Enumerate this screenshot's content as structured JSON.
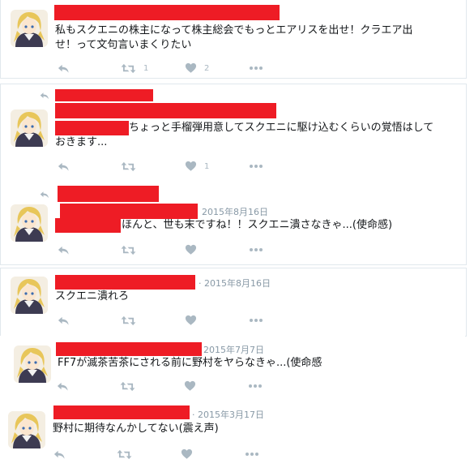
{
  "tweets": [
    {
      "text_lines": [
        "私もスクエニの株主になって株主総会でもっとエアリスを出せ！クラエア出",
        "せ！って文句言いまくりたい"
      ],
      "retweet_count": "1",
      "like_count": "2",
      "retweeted_reply": false,
      "date": ""
    },
    {
      "text_lines": [
        "ちょっと手榴弾用意してスクエニに駆け込むくらいの覚悟はして",
        "おきます..."
      ],
      "retweet_count": "",
      "like_count": "1",
      "retweeted_reply": true,
      "date": ""
    },
    {
      "text_lines": [
        "ほんと、世も末ですね！！スクエニ潰さなきゃ...(使命感)"
      ],
      "retweet_count": "",
      "like_count": "",
      "retweeted_reply": true,
      "date": "2015年8月16日"
    },
    {
      "text_lines": [
        "スクエニ潰れろ"
      ],
      "retweet_count": "",
      "like_count": "",
      "retweeted_reply": false,
      "date": "· 2015年8月16日"
    },
    {
      "text_lines": [
        "FF7が滅茶苦茶にされる前に野村をヤらなきゃ...(使命感"
      ],
      "retweet_count": "",
      "like_count": "",
      "retweeted_reply": false,
      "date": "2015年7月7日"
    },
    {
      "text_lines": [
        "野村に期待なんかしてない(震え声)"
      ],
      "retweet_count": "",
      "like_count": "",
      "retweeted_reply": false,
      "date": "· 2015年3月17日"
    }
  ],
  "colors": {
    "redaction": "#ee1c25",
    "icon_gray": "#aab8c2",
    "border": "#e1e8ed",
    "date_gray": "#8899a6"
  },
  "icons": [
    "reply-icon",
    "retweet-icon",
    "like-icon",
    "more-icon",
    "reply-indicator-icon",
    "avatar"
  ]
}
